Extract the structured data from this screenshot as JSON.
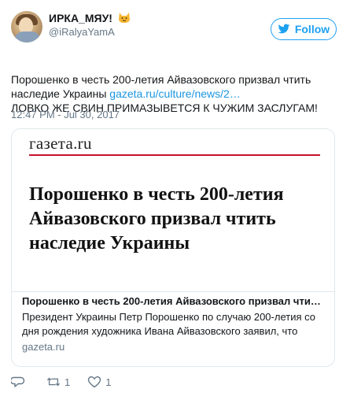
{
  "user": {
    "display_name": "ИРКА_МЯУ!",
    "username": "@iRalyaYamA",
    "emoji_icon": "smiling-cat-icon"
  },
  "follow_button": {
    "label": "Follow",
    "icon": "bird-icon",
    "color": "#1da1f2"
  },
  "tweet": {
    "text_line1": "Порошенко в честь 200-летия Айвазовского призвал чтить наследие Украины",
    "link": "gazeta.ru/culture/news/2…",
    "text_line2": "ЛОВКО ЖЕ СВИН ПРИМАЗЫВЕТСЯ К ЧУЖИМ ЗАСЛУГАМ!",
    "timestamp": "12:47 PM - Jul 30, 2017"
  },
  "card": {
    "logo": "газета.ru",
    "headline": "Порошенко в честь 200-летия Айвазовского призвал чтить наследие Украины",
    "title": "Порошенко в честь 200-летия Айвазовского призвал чтить…",
    "description": "Президент Украины Петр Порошенко по случаю 200-летия со дня рождения художника Ивана Айвазовского заявил, что",
    "domain": "gazeta.ru",
    "accent_color": "#c8102e"
  },
  "actions": {
    "reply_icon": "reply-icon",
    "retweet_icon": "retweet-icon",
    "retweet_count": "1",
    "like_icon": "heart-icon",
    "like_count": "1"
  },
  "colors": {
    "link": "#1b95e0",
    "secondary_text": "#657786",
    "border": "#e1e8ed"
  }
}
